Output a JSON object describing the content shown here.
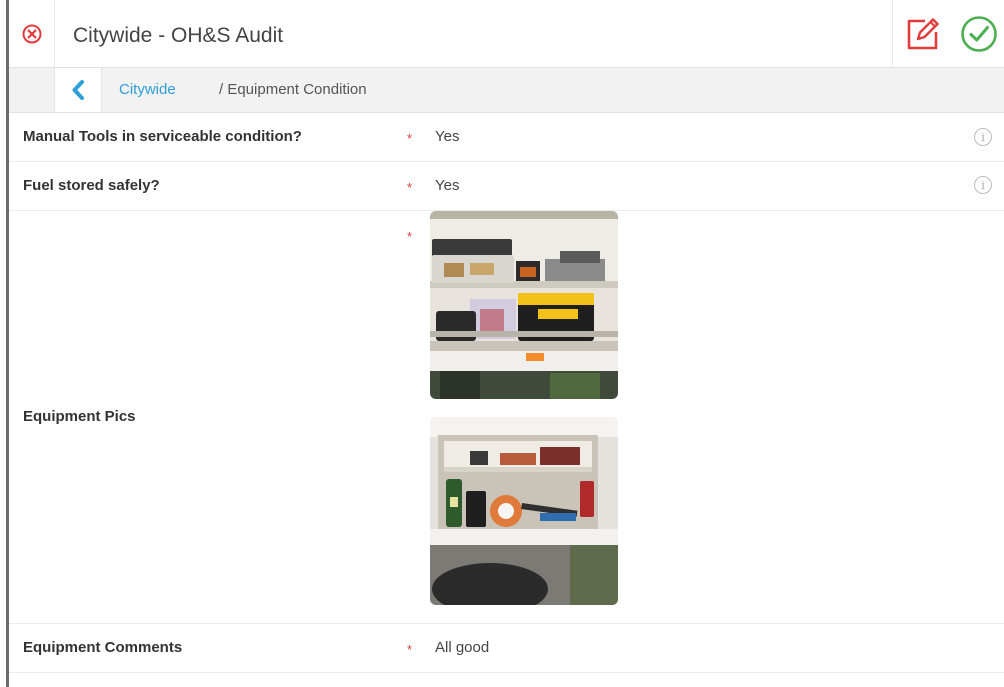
{
  "header": {
    "title": "Citywide - OH&S Audit",
    "close_icon": "close-circle-icon",
    "edit_icon": "edit-pencil-icon",
    "confirm_icon": "check-circle-icon",
    "colors": {
      "red": "#e23b3b",
      "green": "#4caf50"
    }
  },
  "breadcrumb": {
    "back_icon": "chevron-left-icon",
    "parent": "Citywide",
    "current": "/ Equipment Condition"
  },
  "form": {
    "rows": [
      {
        "label": "Manual Tools in serviceable condition?",
        "required": "*",
        "value": "Yes",
        "info_icon": "info-icon"
      },
      {
        "label": "Fuel stored safely?",
        "required": "*",
        "value": "Yes",
        "info_icon": "info-icon"
      },
      {
        "label": "Equipment Pics",
        "required": "*",
        "photos": [
          "equipment-photo-1",
          "equipment-photo-2"
        ]
      },
      {
        "label": "Equipment Comments",
        "required": "*",
        "value": "All good"
      }
    ]
  }
}
